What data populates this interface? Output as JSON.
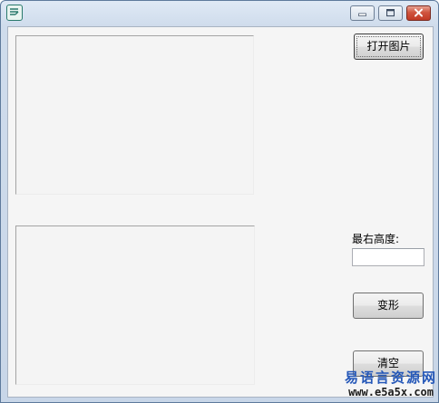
{
  "window": {
    "buttons": {
      "minimize": "minimize",
      "maximize": "maximize",
      "close": "close"
    }
  },
  "controls": {
    "open_image_label": "打开图片",
    "max_height_label": "最右高度:",
    "max_height_value": "",
    "transform_label": "变形",
    "clear_label": "清空"
  },
  "watermark": {
    "site_name": "易语言资源网",
    "url": "www.e5a5x.com"
  },
  "colors": {
    "close_button": "#c13a25",
    "watermark_text": "#2457b8"
  },
  "icons": [
    "app-icon",
    "minimize-icon",
    "maximize-icon",
    "close-icon"
  ]
}
